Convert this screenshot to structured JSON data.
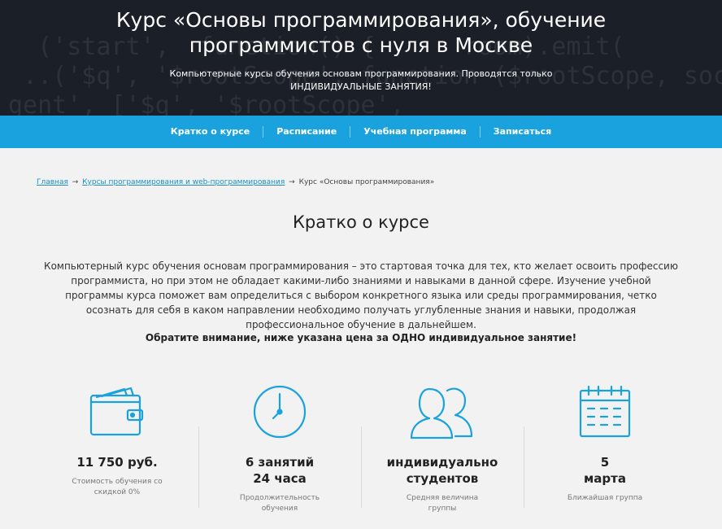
{
  "hero": {
    "title": "Курс «Основы программирования», обучение программистов с нуля в Москве",
    "subtitle": "Компьютерные курсы обучения основам программирования. Проводятся только ИНДИВИДУАЛЬНЫЕ ЗАНЯТИЯ!"
  },
  "nav": {
    "items": [
      {
        "label": "Кратко о курсе"
      },
      {
        "label": "Расписание"
      },
      {
        "label": "Учебная программа"
      },
      {
        "label": "Записаться"
      }
    ]
  },
  "breadcrumb": {
    "home": "Главная",
    "separator1": "→",
    "category": "Курсы программирования и web-программирования",
    "separator2": "→",
    "current": "Курс «Основы программирования»"
  },
  "section": {
    "title": "Кратко о курсе",
    "description": "Компьютерный курс обучения основам программирования – это стартовая точка для тех, кто желает освоить профессию программиста, но при этом не обладает какими-либо знаниями и навыками в данной сфере. Изучение учебной программы курса поможет вам определиться с выбором конкретного языка или среды программирования, четко осознать для себя в каком направлении необходимо получать углубленные знания и навыки, продолжая профессиональное обучение в дальнейшем.",
    "notice": "Обратите внимание, ниже указана цена за ОДНО индивидуальное занятие!"
  },
  "features": [
    {
      "icon": "wallet-icon",
      "value": "11 750 руб.",
      "label": "Стоимость обучения со\nскидкой 0%"
    },
    {
      "icon": "clock-icon",
      "value": "6 занятий\n24 часа",
      "label": "Продолжительность\nобучения"
    },
    {
      "icon": "people-icon",
      "value": "индивидуально\nстудентов",
      "label": "Средняя величина\nгруппы"
    },
    {
      "icon": "calendar-icon",
      "value": "5\nмарта",
      "label": "Ближайшая группа"
    }
  ],
  "colors": {
    "accent": "#1aa2df",
    "hero_bg": "#1b1f27"
  }
}
